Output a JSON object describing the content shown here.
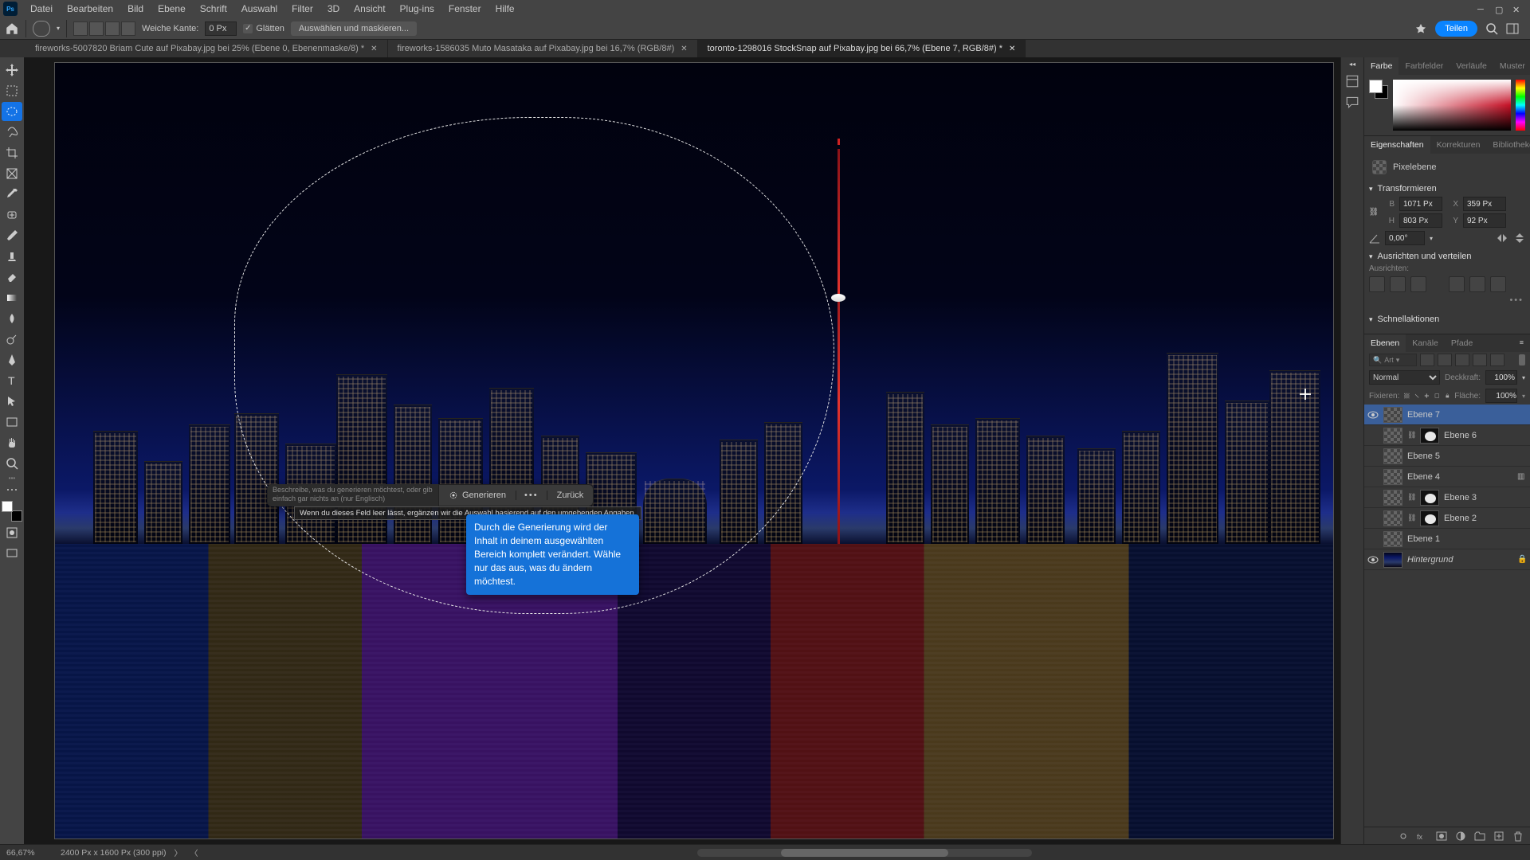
{
  "menubar": {
    "items": [
      "Datei",
      "Bearbeiten",
      "Bild",
      "Ebene",
      "Schrift",
      "Auswahl",
      "Filter",
      "3D",
      "Ansicht",
      "Plug-ins",
      "Fenster",
      "Hilfe"
    ]
  },
  "optbar": {
    "feather_label": "Weiche Kante:",
    "feather_value": "0 Px",
    "antialias": "Glätten",
    "select_mask": "Auswählen und maskieren...",
    "share": "Teilen"
  },
  "tabs": [
    {
      "title": "fireworks-5007820 Briam Cute auf Pixabay.jpg bei 25% (Ebene 0, Ebenenmaske/8) *",
      "active": false
    },
    {
      "title": "fireworks-1586035 Muto Masataka auf Pixabay.jpg bei 16,7% (RGB/8#)",
      "active": false
    },
    {
      "title": "toronto-1298016 StockSnap auf Pixabay.jpg bei 66,7% (Ebene 7, RGB/8#) *",
      "active": true
    }
  ],
  "context_bar": {
    "prompt_placeholder": "Beschreibe, was du generieren möchtest, oder gib einfach gar nichts an (nur Englisch)",
    "generate": "Generieren",
    "back": "Zurück",
    "hint": "Wenn du dieses Feld leer lässt, ergänzen wir die Auswahl basierend auf den umgebenden Angaben."
  },
  "tooltip": "Durch die Generierung wird der Inhalt in deinem ausgewählten Bereich komplett verändert. Wähle nur das aus, was du ändern möchtest.",
  "color_panel": {
    "tabs": [
      "Farbe",
      "Farbfelder",
      "Verläufe",
      "Muster"
    ]
  },
  "props_panel": {
    "tabs": [
      "Eigenschaften",
      "Korrekturen",
      "Bibliotheken"
    ],
    "kind": "Pixelebene",
    "sect_transform": "Transformieren",
    "b_label": "B",
    "b_value": "1071 Px",
    "x_label": "X",
    "x_value": "359 Px",
    "h_label": "H",
    "h_value": "803 Px",
    "y_label": "Y",
    "y_value": "92 Px",
    "angle": "0,00°",
    "sect_align": "Ausrichten und verteilen",
    "align_label": "Ausrichten:",
    "sect_quick": "Schnellaktionen"
  },
  "layers_panel": {
    "tabs": [
      "Ebenen",
      "Kanäle",
      "Pfade"
    ],
    "filter_kind": "Art",
    "blend_mode": "Normal",
    "opacity_label": "Deckkraft:",
    "opacity_value": "100%",
    "lock_label": "Fixieren:",
    "fill_label": "Fläche:",
    "fill_value": "100%",
    "layers": [
      {
        "name": "Ebene 7",
        "visible": true,
        "mask": false,
        "selected": true,
        "bg": false
      },
      {
        "name": "Ebene 6",
        "visible": false,
        "mask": true,
        "selected": false,
        "bg": false
      },
      {
        "name": "Ebene 5",
        "visible": false,
        "mask": false,
        "selected": false,
        "bg": false
      },
      {
        "name": "Ebene 4",
        "visible": false,
        "mask": false,
        "selected": false,
        "bg": false
      },
      {
        "name": "Ebene 3",
        "visible": false,
        "mask": true,
        "selected": false,
        "bg": false
      },
      {
        "name": "Ebene 2",
        "visible": false,
        "mask": true,
        "selected": false,
        "bg": false
      },
      {
        "name": "Ebene 1",
        "visible": false,
        "mask": false,
        "selected": false,
        "bg": false
      },
      {
        "name": "Hintergrund",
        "visible": true,
        "mask": false,
        "selected": false,
        "bg": true
      }
    ]
  },
  "statusbar": {
    "zoom": "66,67%",
    "docinfo": "2400 Px x 1600 Px (300 ppi)"
  }
}
